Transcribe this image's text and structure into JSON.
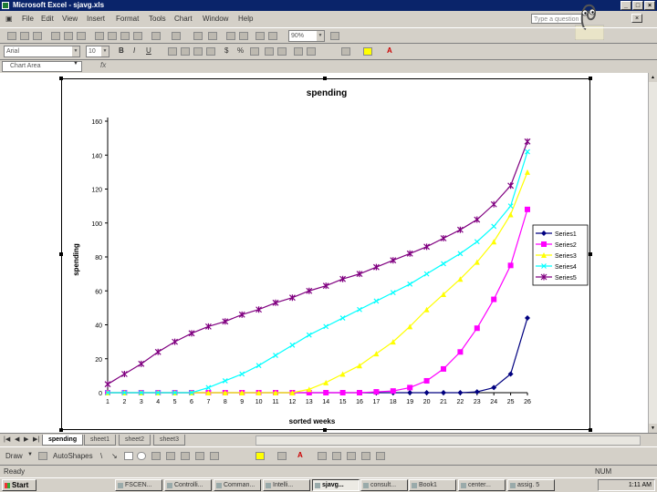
{
  "window": {
    "title": "Microsoft Excel - sjavg.xls"
  },
  "menu": [
    "File",
    "Edit",
    "View",
    "Insert",
    "Format",
    "Tools",
    "Chart",
    "Window",
    "Help"
  ],
  "ask_placeholder": "Type a question",
  "toolbar": {
    "zoom": "90%"
  },
  "format_bar": {
    "font": "Arial",
    "size": "10"
  },
  "namebox": {
    "value": "Chart Area"
  },
  "formula_bar": {
    "fx": "fx"
  },
  "sheet_tabs": [
    "spending",
    "sheet1",
    "sheet2",
    "sheet3"
  ],
  "active_tab": "spending",
  "draw_bar": {
    "draw": "Draw",
    "autoshapes": "AutoShapes"
  },
  "status": {
    "left": "Ready",
    "right": "NUM"
  },
  "taskbar": {
    "start": "Start",
    "tasks": [
      "FSCEN...",
      "Controlli...",
      "Comman...",
      "Intelli...",
      "sjavg...",
      "consult...",
      "Book1",
      "center...",
      "assig. 5"
    ],
    "active_task": "sjavg...",
    "clock": "1:11 AM"
  },
  "colors": {
    "titlebar": "#0a246a",
    "series": [
      "#000080",
      "#ff00ff",
      "#ffff00",
      "#00ffff",
      "#800080"
    ]
  },
  "chart_data": {
    "type": "line",
    "title": "spending",
    "xlabel": "sorted weeks",
    "ylabel": "spending",
    "ylim": [
      0,
      160
    ],
    "yticks": [
      0,
      20,
      40,
      60,
      80,
      100,
      120,
      140,
      160
    ],
    "legend_position": "right",
    "categories": [
      1,
      2,
      3,
      4,
      5,
      6,
      7,
      8,
      9,
      10,
      11,
      12,
      13,
      14,
      15,
      16,
      17,
      18,
      19,
      20,
      21,
      22,
      23,
      24,
      25,
      26
    ],
    "series": [
      {
        "name": "Series1",
        "marker": "diamond",
        "values": [
          0,
          0,
          0,
          0,
          0,
          0,
          0,
          0,
          0,
          0,
          0,
          0,
          0,
          0,
          0,
          0,
          0,
          0,
          0,
          0,
          0,
          0,
          0.5,
          3,
          11,
          44
        ]
      },
      {
        "name": "Series2",
        "marker": "square",
        "values": [
          0,
          0,
          0,
          0,
          0,
          0,
          0,
          0,
          0,
          0,
          0,
          0,
          0,
          0,
          0,
          0,
          0.5,
          1,
          3,
          7,
          14,
          24,
          38,
          55,
          75,
          108
        ]
      },
      {
        "name": "Series3",
        "marker": "triangle",
        "values": [
          0,
          0,
          0,
          0,
          0,
          0,
          0,
          0,
          0,
          0,
          0,
          0,
          2,
          6,
          11,
          16,
          23,
          30,
          39,
          49,
          58,
          67,
          77,
          89,
          105,
          130
        ]
      },
      {
        "name": "Series4",
        "marker": "x",
        "values": [
          0,
          0,
          0,
          0,
          0,
          0,
          3,
          7,
          11,
          16,
          22,
          28,
          34,
          39,
          44,
          49,
          54,
          59,
          64,
          70,
          76,
          82,
          89,
          98,
          110,
          142
        ]
      },
      {
        "name": "Series5",
        "marker": "star",
        "values": [
          5,
          11,
          17,
          24,
          30,
          35,
          39,
          42,
          46,
          49,
          53,
          56,
          60,
          63,
          67,
          70,
          74,
          78,
          82,
          86,
          91,
          96,
          102,
          111,
          122,
          148
        ]
      }
    ]
  }
}
